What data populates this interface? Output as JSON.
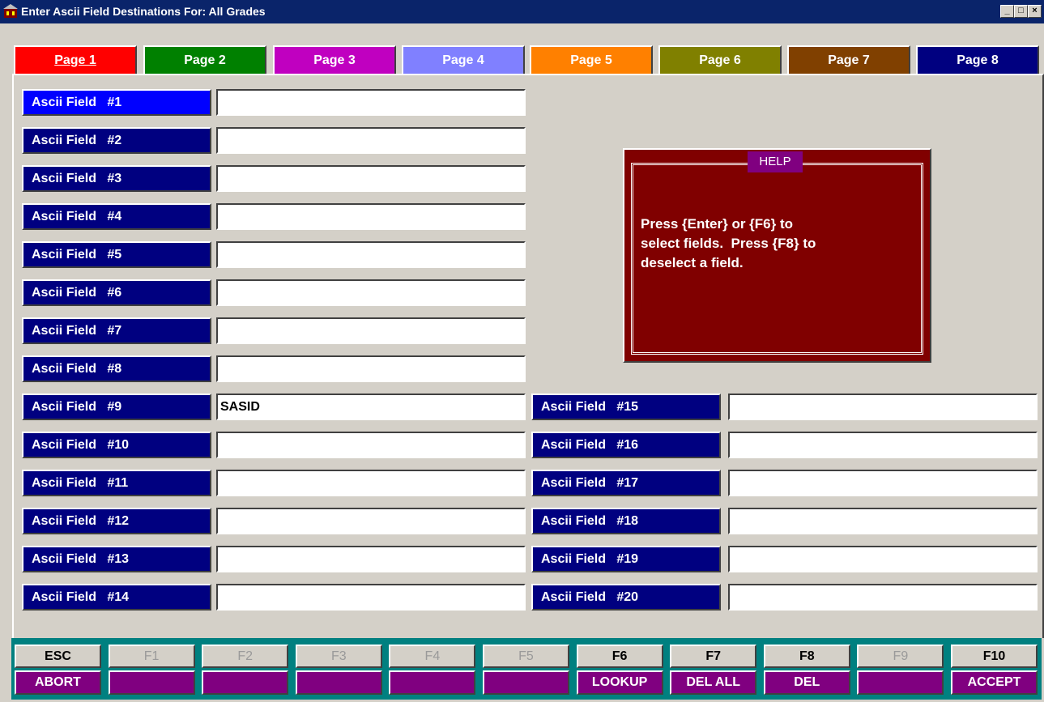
{
  "window": {
    "title": "Enter Ascii Field Destinations For: All Grades",
    "icon": "app-icon",
    "controls": [
      "_",
      "□",
      "×"
    ]
  },
  "tabs": [
    {
      "label": "Page 1",
      "color": "#ff0000",
      "text_color": "#ffffff",
      "active": true
    },
    {
      "label": "Page 2",
      "color": "#008000",
      "text_color": "#ffffff"
    },
    {
      "label": "Page 3",
      "color": "#c000c0",
      "text_color": "#ffffff"
    },
    {
      "label": "Page 4",
      "color": "#8080ff",
      "text_color": "#ffffff"
    },
    {
      "label": "Page 5",
      "color": "#ff8000",
      "text_color": "#ffffff"
    },
    {
      "label": "Page 6",
      "color": "#808000",
      "text_color": "#ffffff"
    },
    {
      "label": "Page 7",
      "color": "#804000",
      "text_color": "#ffffff"
    },
    {
      "label": "Page 8",
      "color": "#000080",
      "text_color": "#ffffff"
    }
  ],
  "fields": [
    {
      "label": "Ascii Field   #1",
      "value": ""
    },
    {
      "label": "Ascii Field   #2",
      "value": ""
    },
    {
      "label": "Ascii Field   #3",
      "value": ""
    },
    {
      "label": "Ascii Field   #4",
      "value": ""
    },
    {
      "label": "Ascii Field   #5",
      "value": ""
    },
    {
      "label": "Ascii Field   #6",
      "value": ""
    },
    {
      "label": "Ascii Field   #7",
      "value": ""
    },
    {
      "label": "Ascii Field   #8",
      "value": ""
    },
    {
      "label": "Ascii Field   #9",
      "value": "SASID"
    },
    {
      "label": "Ascii Field   #10",
      "value": ""
    },
    {
      "label": "Ascii Field   #11",
      "value": ""
    },
    {
      "label": "Ascii Field   #12",
      "value": ""
    },
    {
      "label": "Ascii Field   #13",
      "value": ""
    },
    {
      "label": "Ascii Field   #14",
      "value": ""
    },
    {
      "label": "Ascii Field   #15",
      "value": ""
    },
    {
      "label": "Ascii Field   #16",
      "value": ""
    },
    {
      "label": "Ascii Field   #17",
      "value": ""
    },
    {
      "label": "Ascii Field   #18",
      "value": ""
    },
    {
      "label": "Ascii Field   #19",
      "value": ""
    },
    {
      "label": "Ascii Field   #20",
      "value": ""
    }
  ],
  "help": {
    "title": "HELP",
    "text": "Press {Enter} or {F6} to\nselect fields.  Press {F8} to\ndeselect a field."
  },
  "function_keys": [
    {
      "key": "ESC",
      "action": "ABORT",
      "enabled": true
    },
    {
      "key": "F1",
      "action": "",
      "enabled": false
    },
    {
      "key": "F2",
      "action": "",
      "enabled": false
    },
    {
      "key": "F3",
      "action": "",
      "enabled": false
    },
    {
      "key": "F4",
      "action": "",
      "enabled": false
    },
    {
      "key": "F5",
      "action": "",
      "enabled": false
    },
    {
      "key": "F6",
      "action": "LOOKUP",
      "enabled": true
    },
    {
      "key": "F7",
      "action": "DEL ALL",
      "enabled": true
    },
    {
      "key": "F8",
      "action": "DEL",
      "enabled": true
    },
    {
      "key": "F9",
      "action": "",
      "enabled": false
    },
    {
      "key": "F10",
      "action": "ACCEPT",
      "enabled": true
    }
  ]
}
